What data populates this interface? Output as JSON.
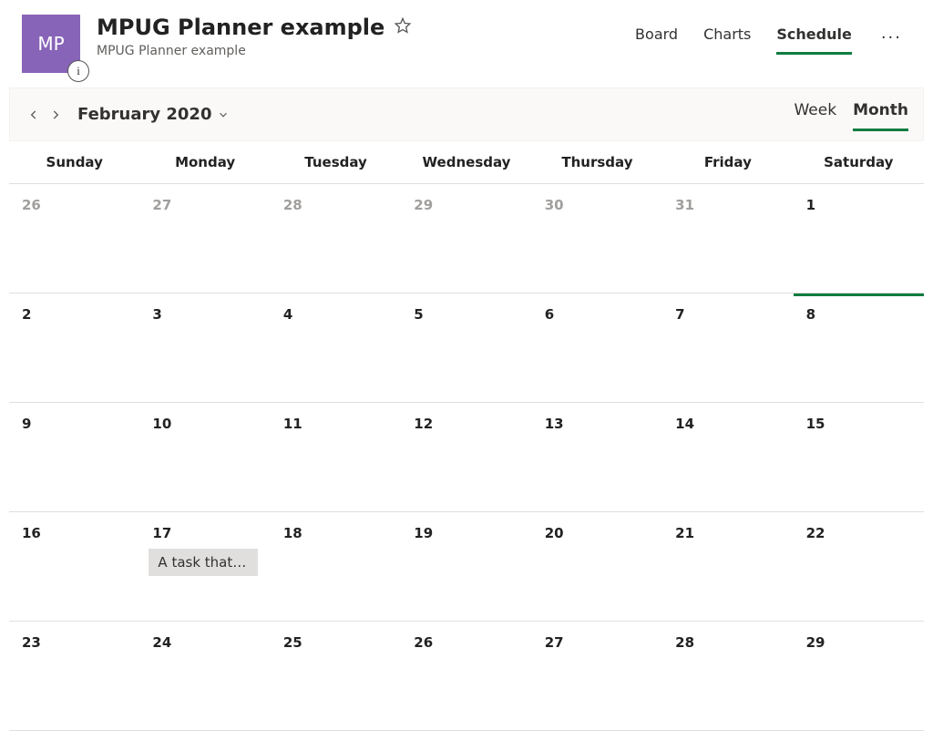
{
  "header": {
    "avatar_initials": "MP",
    "title": "MPUG Planner example",
    "subtitle": "MPUG Planner example"
  },
  "tabs": {
    "board": "Board",
    "charts": "Charts",
    "schedule": "Schedule"
  },
  "toolbar": {
    "month_label": "February 2020",
    "view_week": "Week",
    "view_month": "Month"
  },
  "days_of_week": {
    "sun": "Sunday",
    "mon": "Monday",
    "tue": "Tuesday",
    "wed": "Wednesday",
    "thu": "Thursday",
    "fri": "Friday",
    "sat": "Saturday"
  },
  "weeks": [
    {
      "d": [
        "26",
        "27",
        "28",
        "29",
        "30",
        "31",
        "1"
      ]
    },
    {
      "d": [
        "2",
        "3",
        "4",
        "5",
        "6",
        "7",
        "8"
      ]
    },
    {
      "d": [
        "9",
        "10",
        "11",
        "12",
        "13",
        "14",
        "15"
      ]
    },
    {
      "d": [
        "16",
        "17",
        "18",
        "19",
        "20",
        "21",
        "22"
      ]
    },
    {
      "d": [
        "23",
        "24",
        "25",
        "26",
        "27",
        "28",
        "29"
      ]
    }
  ],
  "task": {
    "label": "A task that s…"
  }
}
